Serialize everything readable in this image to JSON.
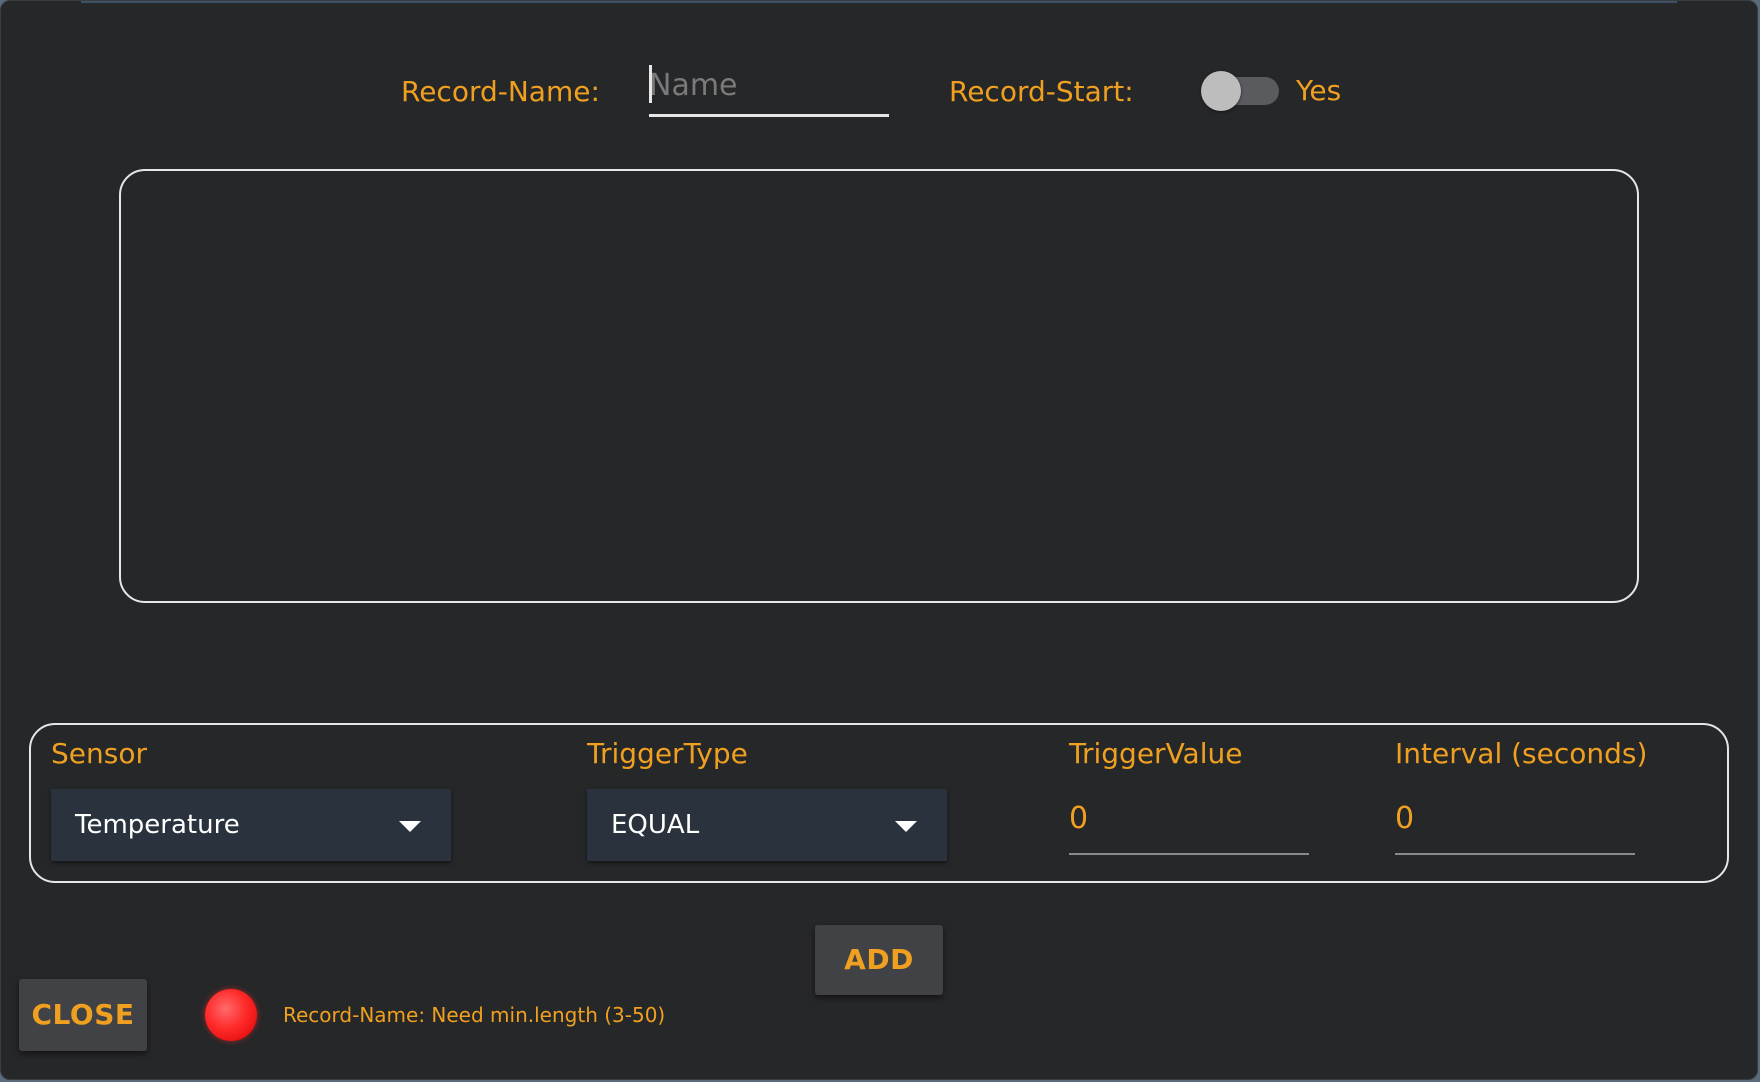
{
  "header": {
    "record_name_label": "Record-Name:",
    "record_name_placeholder": "Name",
    "record_name_value": "",
    "record_start_label": "Record-Start:",
    "record_start_toggle_text": "Yes",
    "record_start_on": false
  },
  "form": {
    "sensor_label": "Sensor",
    "sensor_value": "Temperature",
    "trigger_type_label": "TriggerType",
    "trigger_type_value": "EQUAL",
    "trigger_value_label": "TriggerValue",
    "trigger_value": "0",
    "interval_label": "Interval (seconds)",
    "interval_value": "0"
  },
  "buttons": {
    "add": "ADD",
    "close": "CLOSE"
  },
  "status": {
    "message": "Record-Name: Need min.length (3-50)",
    "indicator_color": "#ff2a2a"
  },
  "colors": {
    "accent": "#f0a020",
    "background": "#262729",
    "select_bg": "#2a323d"
  }
}
